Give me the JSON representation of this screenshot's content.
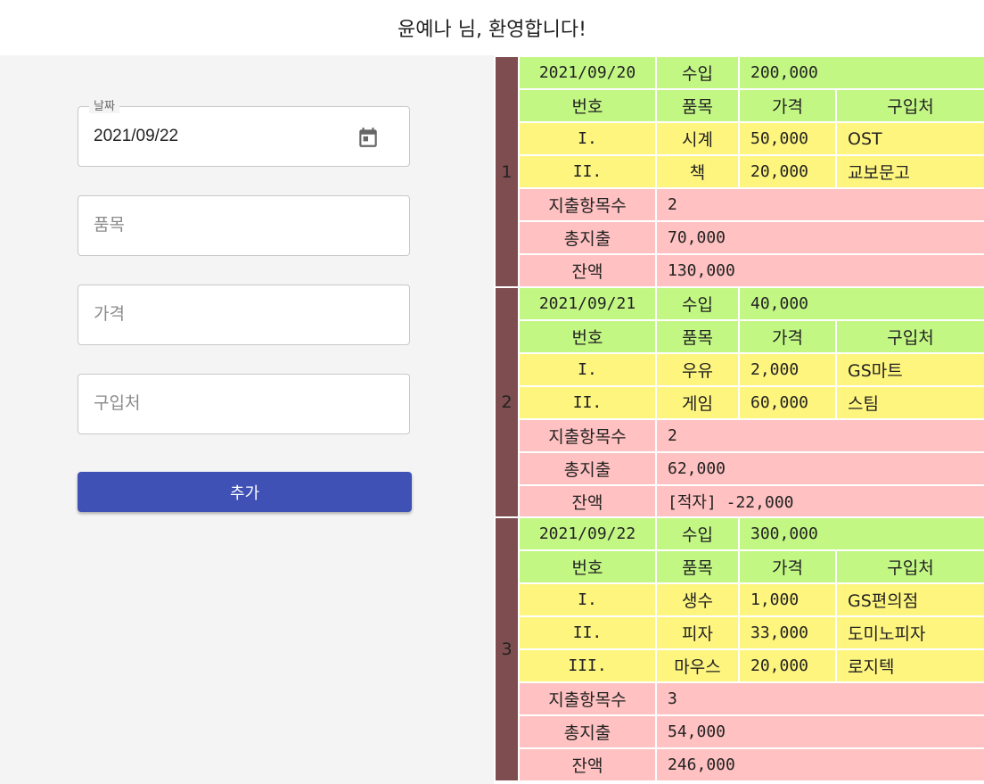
{
  "header": {
    "greeting": "윤예나 님, 환영합니다!"
  },
  "form": {
    "date_label": "날짜",
    "date_value": "2021/09/22",
    "item_placeholder": "품목",
    "price_placeholder": "가격",
    "store_placeholder": "구입처",
    "add_label": "추가"
  },
  "ledger": {
    "labels": {
      "income": "수입",
      "no": "번호",
      "item": "품목",
      "price": "가격",
      "store": "구입처",
      "count": "지출항목수",
      "total": "총지출",
      "balance": "잔액"
    },
    "days": [
      {
        "index": "1",
        "date": "2021/09/20",
        "income": "200,000",
        "items": [
          {
            "no": "I.",
            "item": "시계",
            "price": "50,000",
            "store": "OST"
          },
          {
            "no": "II.",
            "item": "책",
            "price": "20,000",
            "store": "교보문고"
          }
        ],
        "count": "2",
        "total": "70,000",
        "balance": "130,000",
        "deficit": false
      },
      {
        "index": "2",
        "date": "2021/09/21",
        "income": "40,000",
        "items": [
          {
            "no": "I.",
            "item": "우유",
            "price": "2,000",
            "store": "GS마트"
          },
          {
            "no": "II.",
            "item": "게임",
            "price": "60,000",
            "store": "스팀"
          }
        ],
        "count": "2",
        "total": "62,000",
        "balance": "[적자] -22,000",
        "deficit": true
      },
      {
        "index": "3",
        "date": "2021/09/22",
        "income": "300,000",
        "items": [
          {
            "no": "I.",
            "item": "생수",
            "price": "1,000",
            "store": "GS편의점"
          },
          {
            "no": "II.",
            "item": "피자",
            "price": "33,000",
            "store": "도미노피자"
          },
          {
            "no": "III.",
            "item": "마우스",
            "price": "20,000",
            "store": "로지텍"
          }
        ],
        "count": "3",
        "total": "54,000",
        "balance": "246,000",
        "deficit": false
      }
    ]
  },
  "colors": {
    "index_bg": "#7d4d4f",
    "header_row": "#c3f784",
    "item_row": "#fef57f",
    "summary_row": "#ffc1c1",
    "button": "#3f51b5",
    "deficit_text": "#ee2222"
  },
  "icons": {
    "date_picker": "calendar-icon"
  }
}
